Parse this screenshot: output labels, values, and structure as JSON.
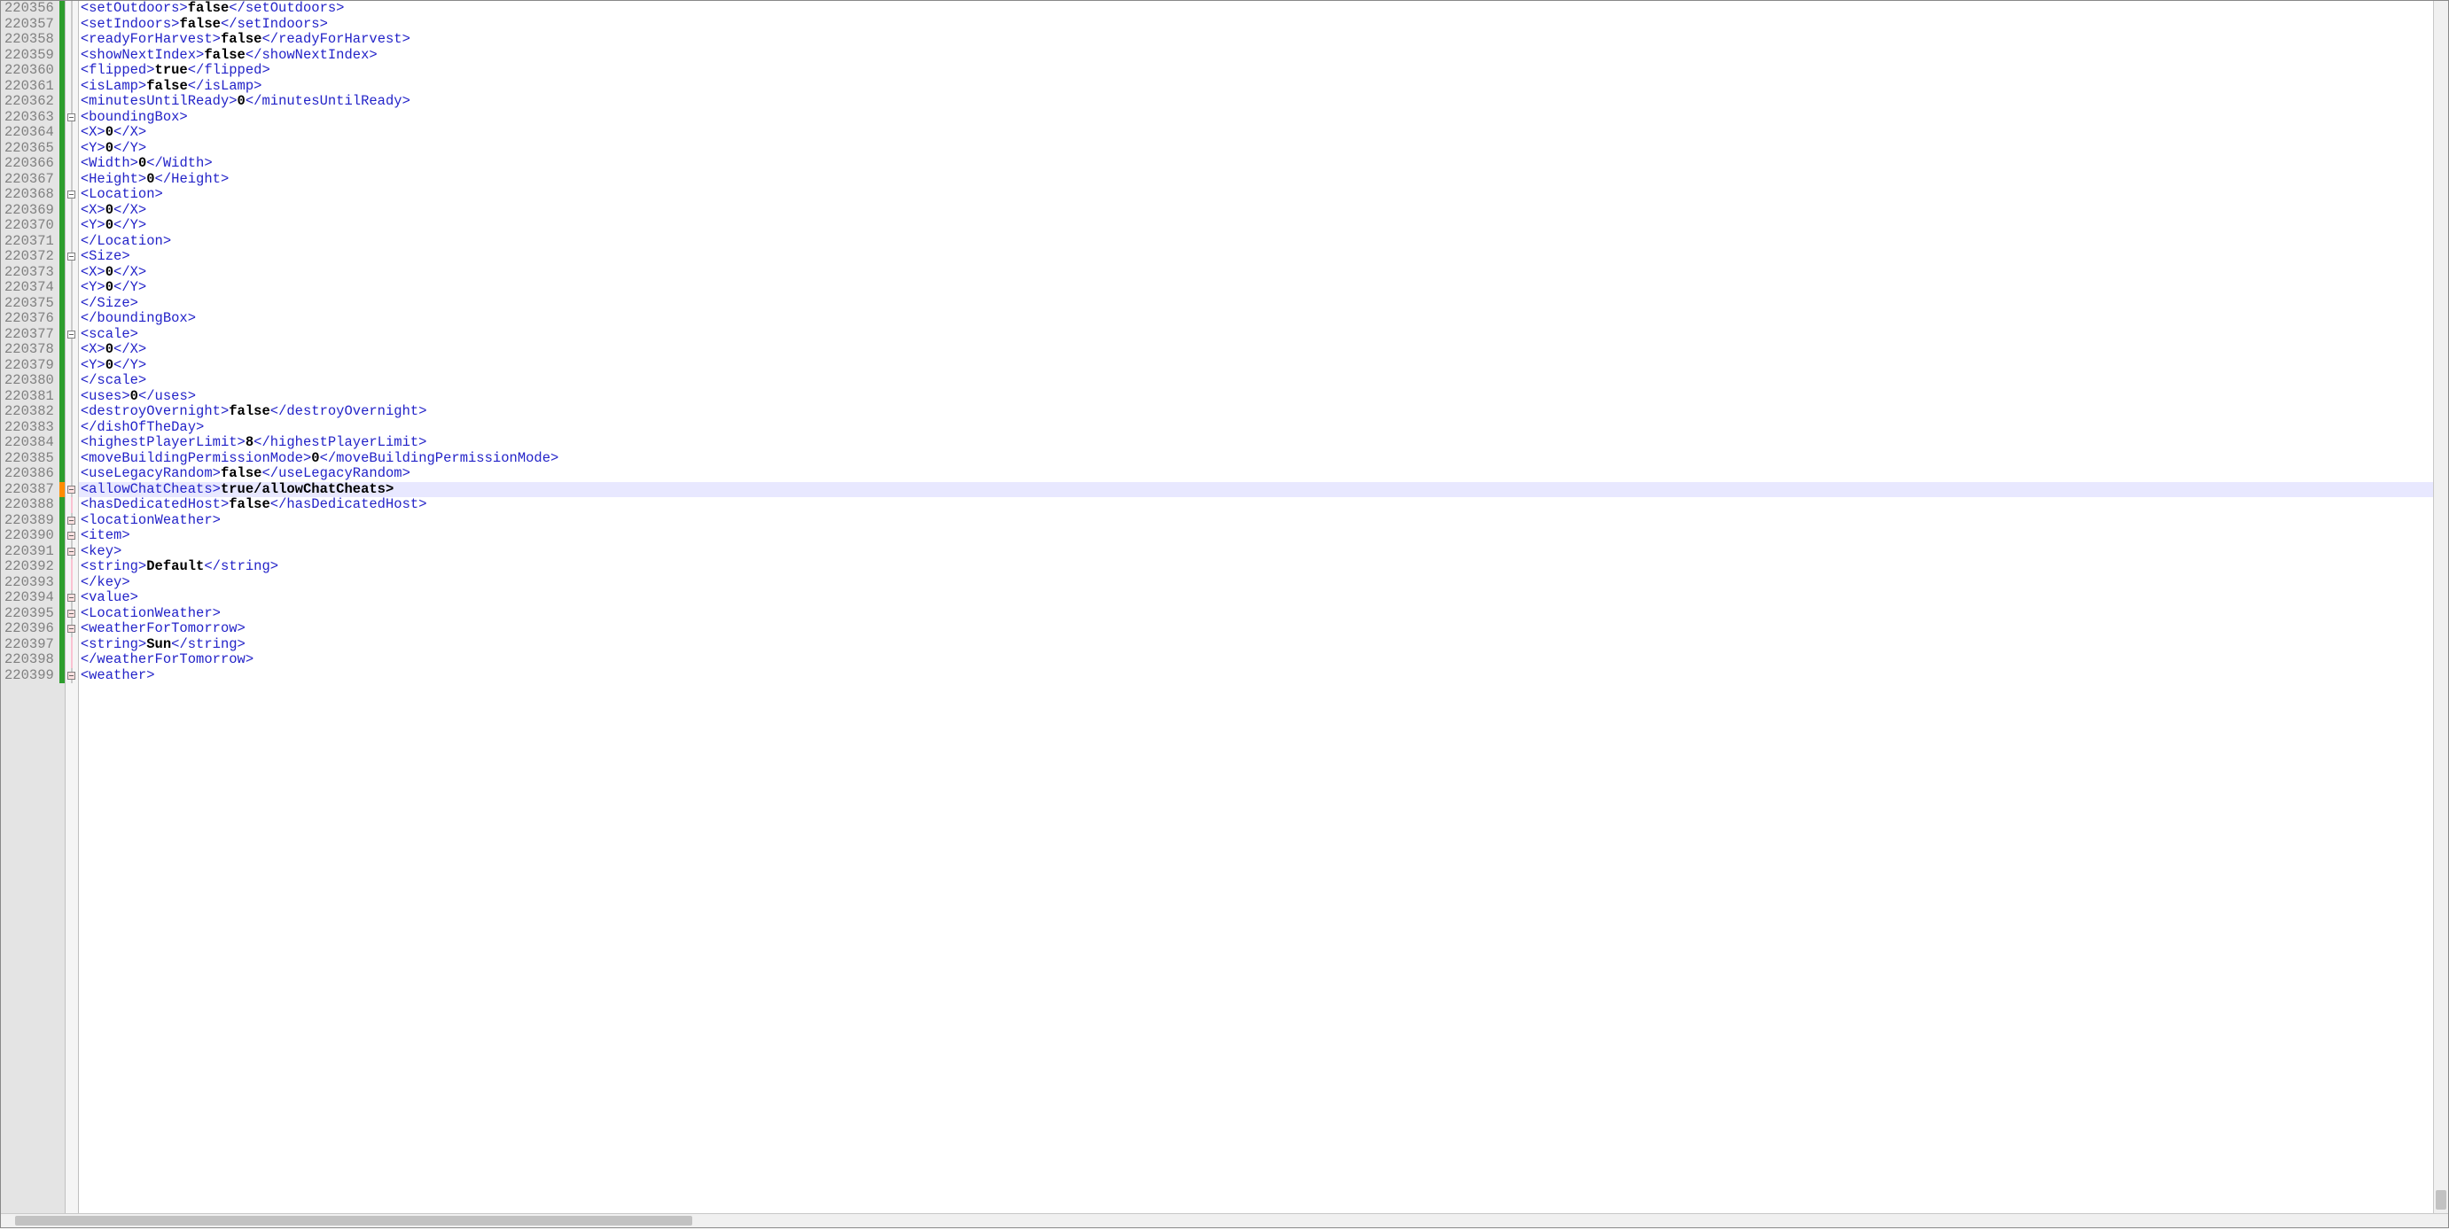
{
  "editor": {
    "highlightLine": 220387,
    "startLine": 220356,
    "lines": [
      {
        "n": 220356,
        "change": "green",
        "fold": "line",
        "indent": 10,
        "tokens": [
          [
            "tag",
            "<setOutdoors>"
          ],
          [
            "val",
            "false"
          ],
          [
            "tag",
            "</setOutdoors>"
          ]
        ]
      },
      {
        "n": 220357,
        "change": "green",
        "fold": "line",
        "indent": 10,
        "tokens": [
          [
            "tag",
            "<setIndoors>"
          ],
          [
            "val",
            "false"
          ],
          [
            "tag",
            "</setIndoors>"
          ]
        ]
      },
      {
        "n": 220358,
        "change": "green",
        "fold": "line",
        "indent": 10,
        "tokens": [
          [
            "tag",
            "<readyForHarvest>"
          ],
          [
            "val",
            "false"
          ],
          [
            "tag",
            "</readyForHarvest>"
          ]
        ]
      },
      {
        "n": 220359,
        "change": "green",
        "fold": "line",
        "indent": 10,
        "tokens": [
          [
            "tag",
            "<showNextIndex>"
          ],
          [
            "val",
            "false"
          ],
          [
            "tag",
            "</showNextIndex>"
          ]
        ]
      },
      {
        "n": 220360,
        "change": "green",
        "fold": "line",
        "indent": 10,
        "tokens": [
          [
            "tag",
            "<flipped>"
          ],
          [
            "val",
            "true"
          ],
          [
            "tag",
            "</flipped>"
          ]
        ]
      },
      {
        "n": 220361,
        "change": "green",
        "fold": "line",
        "indent": 10,
        "tokens": [
          [
            "tag",
            "<isLamp>"
          ],
          [
            "val",
            "false"
          ],
          [
            "tag",
            "</isLamp>"
          ]
        ]
      },
      {
        "n": 220362,
        "change": "green",
        "fold": "line",
        "indent": 10,
        "tokens": [
          [
            "tag",
            "<minutesUntilReady>"
          ],
          [
            "val",
            "0"
          ],
          [
            "tag",
            "</minutesUntilReady>"
          ]
        ]
      },
      {
        "n": 220363,
        "change": "green",
        "fold": "open",
        "indent": 10,
        "tokens": [
          [
            "tag",
            "<boundingBox>"
          ]
        ]
      },
      {
        "n": 220364,
        "change": "green",
        "fold": "line",
        "indent": 12,
        "tokens": [
          [
            "tag",
            "<X>"
          ],
          [
            "val",
            "0"
          ],
          [
            "tag",
            "</X>"
          ]
        ]
      },
      {
        "n": 220365,
        "change": "green",
        "fold": "line",
        "indent": 12,
        "tokens": [
          [
            "tag",
            "<Y>"
          ],
          [
            "val",
            "0"
          ],
          [
            "tag",
            "</Y>"
          ]
        ]
      },
      {
        "n": 220366,
        "change": "green",
        "fold": "line",
        "indent": 12,
        "tokens": [
          [
            "tag",
            "<Width>"
          ],
          [
            "val",
            "0"
          ],
          [
            "tag",
            "</Width>"
          ]
        ]
      },
      {
        "n": 220367,
        "change": "green",
        "fold": "line",
        "indent": 12,
        "tokens": [
          [
            "tag",
            "<Height>"
          ],
          [
            "val",
            "0"
          ],
          [
            "tag",
            "</Height>"
          ]
        ]
      },
      {
        "n": 220368,
        "change": "green",
        "fold": "open",
        "indent": 12,
        "tokens": [
          [
            "tag",
            "<Location>"
          ]
        ]
      },
      {
        "n": 220369,
        "change": "green",
        "fold": "line",
        "indent": 14,
        "tokens": [
          [
            "tag",
            "<X>"
          ],
          [
            "val",
            "0"
          ],
          [
            "tag",
            "</X>"
          ]
        ]
      },
      {
        "n": 220370,
        "change": "green",
        "fold": "line",
        "indent": 14,
        "tokens": [
          [
            "tag",
            "<Y>"
          ],
          [
            "val",
            "0"
          ],
          [
            "tag",
            "</Y>"
          ]
        ]
      },
      {
        "n": 220371,
        "change": "green",
        "fold": "line",
        "indent": 12,
        "tokens": [
          [
            "tag",
            "</Location>"
          ]
        ]
      },
      {
        "n": 220372,
        "change": "green",
        "fold": "open",
        "indent": 12,
        "tokens": [
          [
            "tag",
            "<Size>"
          ]
        ]
      },
      {
        "n": 220373,
        "change": "green",
        "fold": "line",
        "indent": 14,
        "tokens": [
          [
            "tag",
            "<X>"
          ],
          [
            "val",
            "0"
          ],
          [
            "tag",
            "</X>"
          ]
        ]
      },
      {
        "n": 220374,
        "change": "green",
        "fold": "line",
        "indent": 14,
        "tokens": [
          [
            "tag",
            "<Y>"
          ],
          [
            "val",
            "0"
          ],
          [
            "tag",
            "</Y>"
          ]
        ]
      },
      {
        "n": 220375,
        "change": "green",
        "fold": "line",
        "indent": 12,
        "tokens": [
          [
            "tag",
            "</Size>"
          ]
        ]
      },
      {
        "n": 220376,
        "change": "green",
        "fold": "line",
        "indent": 10,
        "tokens": [
          [
            "tag",
            "</boundingBox>"
          ]
        ]
      },
      {
        "n": 220377,
        "change": "green",
        "fold": "open",
        "indent": 10,
        "tokens": [
          [
            "tag",
            "<scale>"
          ]
        ]
      },
      {
        "n": 220378,
        "change": "green",
        "fold": "line",
        "indent": 12,
        "tokens": [
          [
            "tag",
            "<X>"
          ],
          [
            "val",
            "0"
          ],
          [
            "tag",
            "</X>"
          ]
        ]
      },
      {
        "n": 220379,
        "change": "green",
        "fold": "line",
        "indent": 12,
        "tokens": [
          [
            "tag",
            "<Y>"
          ],
          [
            "val",
            "0"
          ],
          [
            "tag",
            "</Y>"
          ]
        ]
      },
      {
        "n": 220380,
        "change": "green",
        "fold": "line",
        "indent": 10,
        "tokens": [
          [
            "tag",
            "</scale>"
          ]
        ]
      },
      {
        "n": 220381,
        "change": "green",
        "fold": "line",
        "indent": 10,
        "tokens": [
          [
            "tag",
            "<uses>"
          ],
          [
            "val",
            "0"
          ],
          [
            "tag",
            "</uses>"
          ]
        ]
      },
      {
        "n": 220382,
        "change": "green",
        "fold": "line",
        "indent": 10,
        "tokens": [
          [
            "tag",
            "<destroyOvernight>"
          ],
          [
            "val",
            "false"
          ],
          [
            "tag",
            "</destroyOvernight>"
          ]
        ]
      },
      {
        "n": 220383,
        "change": "green",
        "fold": "line",
        "indent": 8,
        "tokens": [
          [
            "tag",
            "</dishOfTheDay>"
          ]
        ]
      },
      {
        "n": 220384,
        "change": "green",
        "fold": "line",
        "indent": 8,
        "tokens": [
          [
            "tag",
            "<highestPlayerLimit>"
          ],
          [
            "val",
            "8"
          ],
          [
            "tag",
            "</highestPlayerLimit>"
          ]
        ]
      },
      {
        "n": 220385,
        "change": "green",
        "fold": "line",
        "indent": 8,
        "tokens": [
          [
            "tag",
            "<moveBuildingPermissionMode>"
          ],
          [
            "val",
            "0"
          ],
          [
            "tag",
            "</moveBuildingPermissionMode>"
          ]
        ]
      },
      {
        "n": 220386,
        "change": "green",
        "fold": "line",
        "indent": 8,
        "tokens": [
          [
            "tag",
            "<useLegacyRandom>"
          ],
          [
            "val",
            "false"
          ],
          [
            "tag",
            "</useLegacyRandom>"
          ]
        ]
      },
      {
        "n": 220387,
        "change": "orange",
        "fold": "open",
        "foldShade": true,
        "indent": 8,
        "tokens": [
          [
            "tag",
            "<allowChatCheats>"
          ],
          [
            "val",
            "true/allowChatCheats>"
          ]
        ]
      },
      {
        "n": 220388,
        "change": "green",
        "fold": "line",
        "foldPink": true,
        "indent": 8,
        "tokens": [
          [
            "tag",
            "<hasDedicatedHost>"
          ],
          [
            "val",
            "false"
          ],
          [
            "tag",
            "</hasDedicatedHost>"
          ]
        ]
      },
      {
        "n": 220389,
        "change": "green",
        "fold": "open",
        "foldShade": true,
        "indent": 8,
        "tokens": [
          [
            "tag",
            "<locationWeather>"
          ]
        ]
      },
      {
        "n": 220390,
        "change": "green",
        "fold": "open",
        "foldShade": true,
        "indent": 10,
        "tokens": [
          [
            "tag",
            "<item>"
          ]
        ]
      },
      {
        "n": 220391,
        "change": "green",
        "fold": "open",
        "foldShade": true,
        "indent": 12,
        "tokens": [
          [
            "tag",
            "<key>"
          ]
        ]
      },
      {
        "n": 220392,
        "change": "green",
        "fold": "line",
        "foldPink": true,
        "indent": 14,
        "tokens": [
          [
            "tag",
            "<string>"
          ],
          [
            "val",
            "Default"
          ],
          [
            "tag",
            "</string>"
          ]
        ]
      },
      {
        "n": 220393,
        "change": "green",
        "fold": "line",
        "foldPink": true,
        "indent": 12,
        "tokens": [
          [
            "tag",
            "</key>"
          ]
        ]
      },
      {
        "n": 220394,
        "change": "green",
        "fold": "open",
        "foldShade": true,
        "indent": 12,
        "tokens": [
          [
            "tag",
            "<value>"
          ]
        ]
      },
      {
        "n": 220395,
        "change": "green",
        "fold": "open",
        "foldShade": true,
        "indent": 14,
        "tokens": [
          [
            "tag",
            "<LocationWeather>"
          ]
        ]
      },
      {
        "n": 220396,
        "change": "green",
        "fold": "open",
        "foldShade": true,
        "indent": 16,
        "tokens": [
          [
            "tag",
            "<weatherForTomorrow>"
          ]
        ]
      },
      {
        "n": 220397,
        "change": "green",
        "fold": "line",
        "foldPink": true,
        "indent": 18,
        "tokens": [
          [
            "tag",
            "<string>"
          ],
          [
            "val",
            "Sun"
          ],
          [
            "tag",
            "</string>"
          ]
        ]
      },
      {
        "n": 220398,
        "change": "green",
        "fold": "line",
        "foldPink": true,
        "indent": 16,
        "tokens": [
          [
            "tag",
            "</weatherForTomorrow>"
          ]
        ]
      },
      {
        "n": 220399,
        "change": "green",
        "fold": "open",
        "foldShade": true,
        "indent": 16,
        "tokens": [
          [
            "tag",
            "<weather>"
          ]
        ]
      }
    ]
  }
}
